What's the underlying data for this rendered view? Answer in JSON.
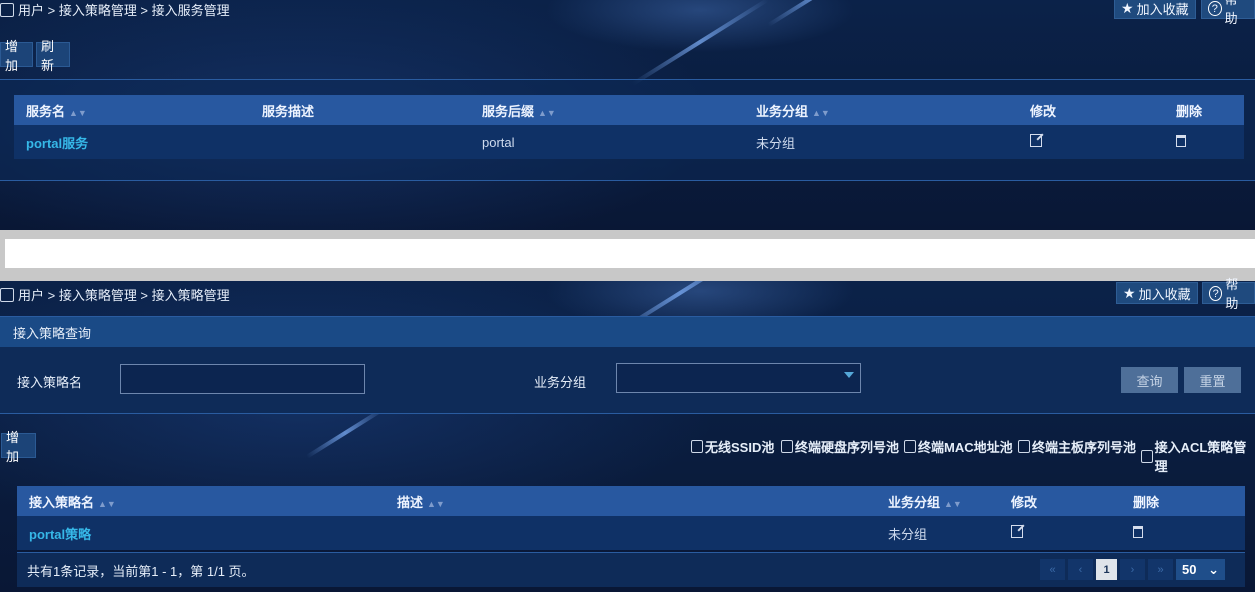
{
  "top": {
    "breadcrumb": "用户 > 接入策略管理 > 接入服务管理",
    "favorite_label": "加入收藏",
    "help_label": "帮助",
    "add_label": "增加",
    "refresh_label": "刷新",
    "table": {
      "headers": [
        "服务名",
        "服务描述",
        "服务后缀",
        "业务分组",
        "修改",
        "删除"
      ],
      "rows": [
        {
          "name": "portal服务",
          "desc": "",
          "suffix": "portal",
          "group": "未分组"
        }
      ]
    }
  },
  "bottom": {
    "breadcrumb": "用户 > 接入策略管理 > 接入策略管理",
    "favorite_label": "加入收藏",
    "help_label": "帮助",
    "query_title": "接入策略查询",
    "policy_name_label": "接入策略名",
    "policy_name_value": "",
    "group_label": "业务分组",
    "group_value": "",
    "query_button": "查询",
    "reset_button": "重置",
    "add_label": "增加",
    "tools": [
      "无线SSID池",
      "终端硬盘序列号池",
      "终端MAC地址池",
      "终端主板序列号池",
      "接入ACL策略管理"
    ],
    "table": {
      "headers": [
        "接入策略名",
        "描述",
        "业务分组",
        "修改",
        "删除"
      ],
      "rows": [
        {
          "name": "portal策略",
          "desc": "",
          "group": "未分组"
        }
      ]
    },
    "footer_text": "共有1条记录，当前第1 - 1，第 1/1 页。",
    "pager": {
      "current_page": "1",
      "page_size": "50"
    }
  },
  "colors": {
    "accent": "#2858a0",
    "link": "#36b8e8",
    "background": "#0a1d40"
  }
}
